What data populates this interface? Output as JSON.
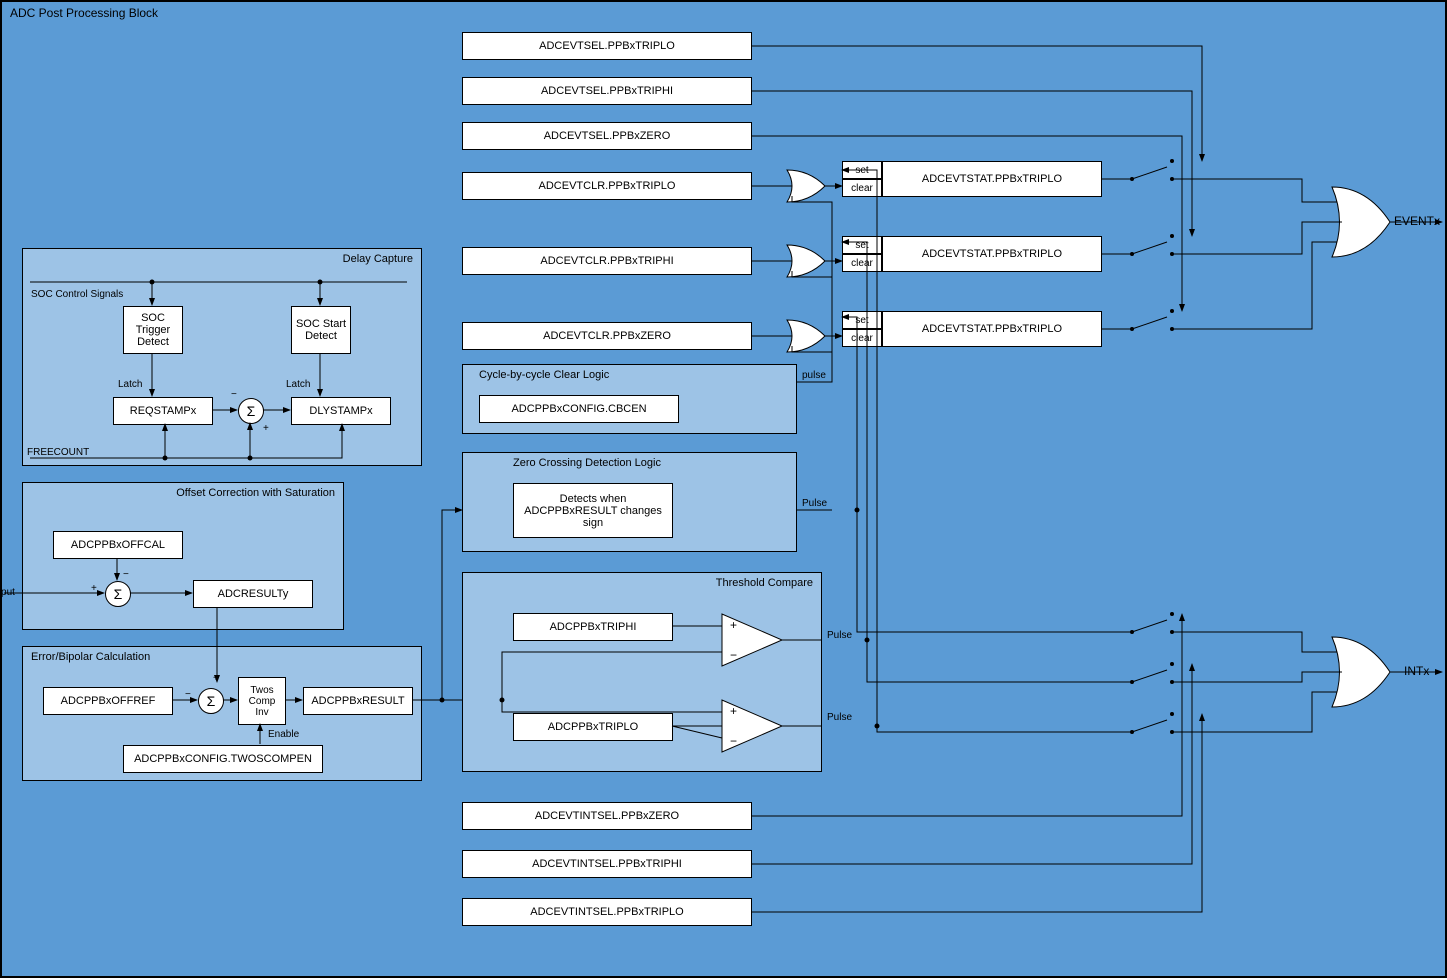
{
  "diagram": {
    "title": "ADC Post Processing Block",
    "outputs": {
      "event": "EVENTx",
      "int": "INTx"
    },
    "top_selects": [
      "ADCEVTSEL.PPBxTRIPLO",
      "ADCEVTSEL.PPBxTRIPHI",
      "ADCEVTSEL.PPBxZERO"
    ],
    "evt_clears": [
      "ADCEVTCLR.PPBxTRIPLO",
      "ADCEVTCLR.PPBxTRIPHI",
      "ADCEVTCLR.PPBxZERO"
    ],
    "evt_stats": [
      "ADCEVTSTAT.PPBxTRIPLO",
      "ADCEVTSTAT.PPBxTRIPLO",
      "ADCEVTSTAT.PPBxTRIPLO"
    ],
    "bot_selects": [
      "ADCEVTINTSEL.PPBxZERO",
      "ADCEVTINTSEL.PPBxTRIPHI",
      "ADCEVTINTSEL.PPBxTRIPLO"
    ],
    "set_label": "set",
    "clear_label": "clear",
    "pulse_label": "pulse",
    "pulse_cap": "Pulse",
    "delay_capture": {
      "title": "Delay Capture",
      "soc_signals": "SOC Control Signals",
      "trigger": "SOC Trigger Detect",
      "start": "SOC Start Detect",
      "latch": "Latch",
      "reqstamp": "REQSTAMPx",
      "dlystamp": "DLYSTAMPx",
      "freecount": "FREECOUNT"
    },
    "offset_correction": {
      "title": "Offset Correction with Saturation",
      "offcal": "ADCPPBxOFFCAL",
      "adc_output": "ADC Output",
      "result": "ADCRESULTy"
    },
    "error_bipolar": {
      "title": "Error/Bipolar Calculation",
      "offref": "ADCPPBxOFFREF",
      "twos_comp": "Twos Comp Inv",
      "enable": "Enable",
      "config": "ADCPPBxCONFIG.TWOSCOMPEN",
      "result": "ADCPPBxRESULT"
    },
    "cycle_clear": {
      "title": "Cycle-by-cycle Clear Logic",
      "config": "ADCPPBxCONFIG.CBCEN"
    },
    "zero_crossing": {
      "title": "Zero Crossing Detection Logic",
      "detect": "Detects when ADCPPBxRESULT changes sign"
    },
    "threshold": {
      "title": "Threshold Compare",
      "triphi": "ADCPPBxTRIPHI",
      "triplo": "ADCPPBxTRIPLO"
    },
    "signs": {
      "plus": "+",
      "minus": "−",
      "sigma": "Σ"
    }
  }
}
